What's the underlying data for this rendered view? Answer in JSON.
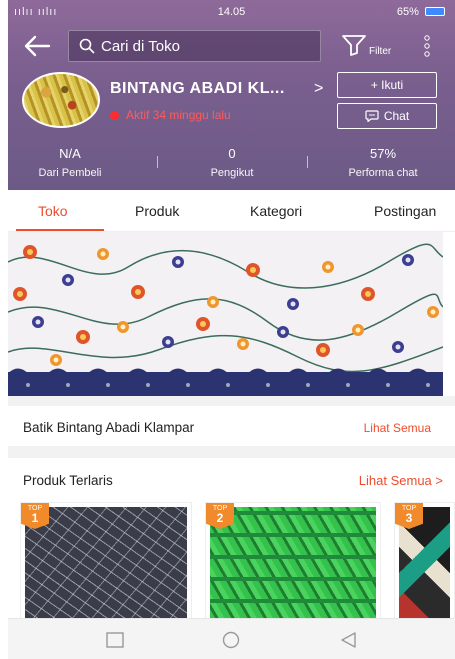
{
  "status_bar": {
    "signal": "ıılıı ıılıı",
    "time": "14.05",
    "battery": "65%"
  },
  "header": {
    "search_placeholder": "Cari di Toko",
    "filter_label": "Filter",
    "shop_name": "BINTANG ABADI KL...",
    "active_status": "Aktif 34 minggu lalu",
    "follow_label": "+ Ikuti",
    "chat_label": "Chat"
  },
  "stats": [
    {
      "value": "N/A",
      "label": "Dari Pembeli"
    },
    {
      "value": "0",
      "label": "Pengikut"
    },
    {
      "value": "57%",
      "label": "Performa chat"
    }
  ],
  "tabs": [
    "Toko",
    "Produk",
    "Kategori",
    "Postingan"
  ],
  "featured": {
    "title": "Batik Bintang Abadi Klampar",
    "link": "Lihat Semua"
  },
  "bestsellers": {
    "title": "Produk Terlaris",
    "link": "Lihat Semua >",
    "products": [
      {
        "badge_top": "TOP",
        "rank": "1"
      },
      {
        "badge_top": "TOP",
        "rank": "2"
      },
      {
        "badge_top": "TOP",
        "rank": "3"
      }
    ]
  },
  "colors": {
    "accent": "#ee4d2d",
    "header_bg": "#7a5f8f",
    "active_red": "#ff2d2d"
  }
}
